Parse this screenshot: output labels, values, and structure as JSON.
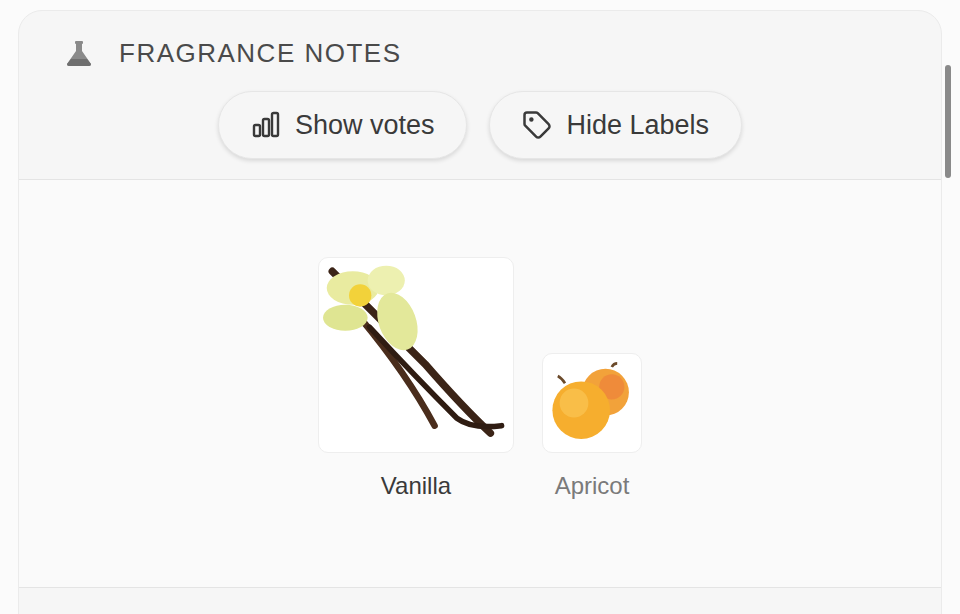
{
  "section": {
    "title": "FRAGRANCE NOTES"
  },
  "buttons": [
    {
      "label": "Show votes",
      "kind": "votes"
    },
    {
      "label": "Hide Labels",
      "kind": "labels"
    }
  ],
  "notes": [
    {
      "name": "Vanilla",
      "level": 1,
      "muted": false,
      "kind": "vanilla"
    },
    {
      "name": "Apricot",
      "level": 0.51,
      "muted": true,
      "kind": "apricot"
    }
  ]
}
